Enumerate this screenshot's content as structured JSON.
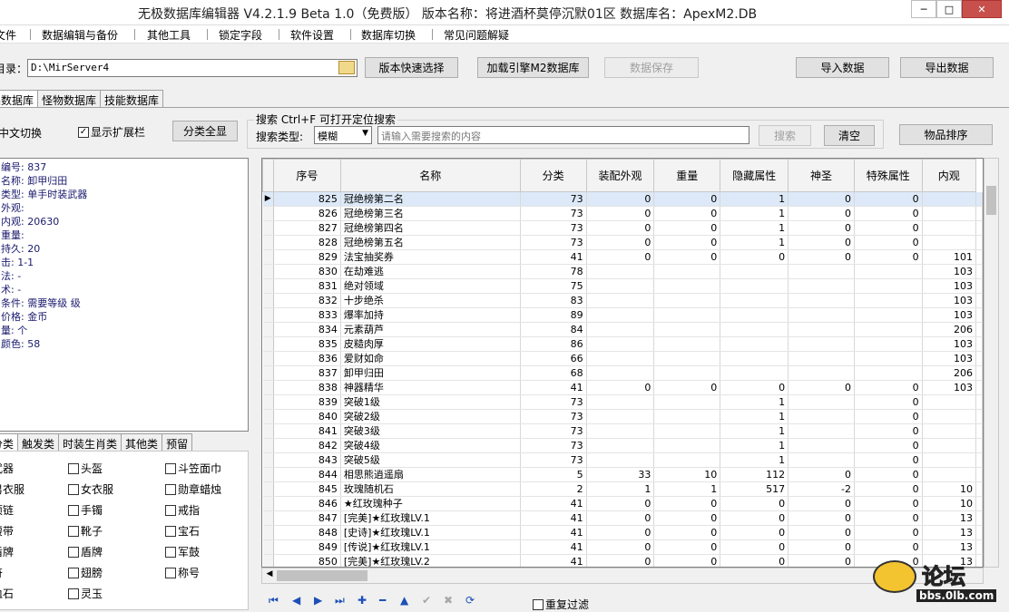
{
  "window": {
    "title": "无极数据库编辑器 V4.2.1.9   Beta 1.0（免费版）   版本名称：将进酒杯莫停沉默01区    数据库名：ApexM2.DB",
    "min": "─",
    "max": "□",
    "close": "✕"
  },
  "menu": [
    "文件",
    "数据编辑与备份",
    "其他工具",
    "锁定字段",
    "软件设置",
    "数据库切换",
    "常见问题解疑"
  ],
  "toolbar": {
    "dir_label": "目录：",
    "dir_value": "D:\\MirServer4",
    "version_quick": "版本快速选择",
    "load_engine": "加载引擎M2数据库",
    "save_data": "数据保存",
    "import_data": "导入数据",
    "export_data": "导出数据"
  },
  "db_tabs": [
    "物品数据库",
    "怪物数据库",
    "技能数据库"
  ],
  "options": {
    "cn_toggle": "中文切换",
    "show_ext": "显示扩展栏",
    "show_ext_checked": true,
    "show_all_categories": "分类全显"
  },
  "search": {
    "title": "搜索   Ctrl+F 可打开定位搜索",
    "type_label": "搜索类型:",
    "type_value": "模糊",
    "placeholder": "请输入需要搜索的内容",
    "search_btn": "搜索",
    "clear_btn": "清空",
    "sort_btn": "物品排序"
  },
  "item_info": [
    "编号: 837",
    "名称: 卸甲归田",
    "类型: 单手时装武器",
    "外观:",
    "内观: 20630",
    "重量:",
    "持久: 20",
    "  击: 1-1",
    "  法: -",
    "  术: -",
    "条件: 需要等级  级",
    "价格: 金币",
    "  量: 个",
    "颜色: 58"
  ],
  "category_tabs": [
    "分类",
    "触发类",
    "时装生肖类",
    "其他类",
    "预留"
  ],
  "categories": [
    [
      "武器",
      "头盔",
      "斗笠面巾"
    ],
    [
      "男衣服",
      "女衣服",
      "勋章蜡烛"
    ],
    [
      "项链",
      "手镯",
      "戒指"
    ],
    [
      "腰带",
      "靴子",
      "宝石"
    ],
    [
      "盾牌",
      "盾牌",
      "军鼓"
    ],
    [
      "符",
      "翅膀",
      "称号"
    ],
    [
      "血石",
      "灵玉",
      ""
    ]
  ],
  "grid": {
    "columns": [
      "序号",
      "名称",
      "分类",
      "装配外观",
      "重量",
      "隐藏属性",
      "神圣",
      "特殊属性",
      "内观"
    ],
    "rows": [
      [
        "825",
        "冠绝榜第二名",
        "73",
        "0",
        "0",
        "1",
        "0",
        "0",
        ""
      ],
      [
        "826",
        "冠绝榜第三名",
        "73",
        "0",
        "0",
        "1",
        "0",
        "0",
        ""
      ],
      [
        "827",
        "冠绝榜第四名",
        "73",
        "0",
        "0",
        "1",
        "0",
        "0",
        ""
      ],
      [
        "828",
        "冠绝榜第五名",
        "73",
        "0",
        "0",
        "1",
        "0",
        "0",
        ""
      ],
      [
        "829",
        "法宝抽奖券",
        "41",
        "0",
        "0",
        "0",
        "0",
        "0",
        "101"
      ],
      [
        "830",
        "在劫难逃",
        "78",
        "",
        "",
        "",
        "",
        "",
        "103"
      ],
      [
        "831",
        "绝对领域",
        "75",
        "",
        "",
        "",
        "",
        "",
        "103"
      ],
      [
        "832",
        "十步绝杀",
        "83",
        "",
        "",
        "",
        "",
        "",
        "103"
      ],
      [
        "833",
        "爆率加持",
        "89",
        "",
        "",
        "",
        "",
        "",
        "103"
      ],
      [
        "834",
        "元素葫芦",
        "84",
        "",
        "",
        "",
        "",
        "",
        "206"
      ],
      [
        "835",
        "皮糙肉厚",
        "86",
        "",
        "",
        "",
        "",
        "",
        "103"
      ],
      [
        "836",
        "爱财如命",
        "66",
        "",
        "",
        "",
        "",
        "",
        "103"
      ],
      [
        "837",
        "卸甲归田",
        "68",
        "",
        "",
        "",
        "",
        "",
        "206"
      ],
      [
        "838",
        "神器精华",
        "41",
        "0",
        "0",
        "0",
        "0",
        "0",
        "103"
      ],
      [
        "839",
        "突破1级",
        "73",
        "",
        "",
        "1",
        "",
        "0",
        ""
      ],
      [
        "840",
        "突破2级",
        "73",
        "",
        "",
        "1",
        "",
        "0",
        ""
      ],
      [
        "841",
        "突破3级",
        "73",
        "",
        "",
        "1",
        "",
        "0",
        ""
      ],
      [
        "842",
        "突破4级",
        "73",
        "",
        "",
        "1",
        "",
        "0",
        ""
      ],
      [
        "843",
        "突破5级",
        "73",
        "",
        "",
        "1",
        "",
        "0",
        ""
      ],
      [
        "844",
        "相思熊逍遥扇",
        "5",
        "33",
        "10",
        "112",
        "0",
        "0",
        ""
      ],
      [
        "845",
        "玫瑰随机石",
        "2",
        "1",
        "1",
        "517",
        "-2",
        "0",
        "10"
      ],
      [
        "846",
        "★红玫瑰种子",
        "41",
        "0",
        "0",
        "0",
        "0",
        "0",
        "10"
      ],
      [
        "847",
        "[完美]★红玫瑰LV.1",
        "41",
        "0",
        "0",
        "0",
        "0",
        "0",
        "13"
      ],
      [
        "848",
        "[史诗]★红玫瑰LV.1",
        "41",
        "0",
        "0",
        "0",
        "0",
        "0",
        "13"
      ],
      [
        "849",
        "[传说]★红玫瑰LV.1",
        "41",
        "0",
        "0",
        "0",
        "0",
        "0",
        "13"
      ],
      [
        "850",
        "[完美]★红玫瑰LV.2",
        "41",
        "0",
        "0",
        "0",
        "0",
        "0",
        "13"
      ]
    ]
  },
  "nav": {
    "icons": [
      "first-icon",
      "prev-icon",
      "next-icon",
      "last-icon",
      "plus-icon",
      "minus-icon",
      "up-icon",
      "check-icon",
      "cancel-icon",
      "refresh-icon"
    ],
    "dup_filter": "重复过滤"
  },
  "watermark": {
    "brand": "论坛",
    "url": "bbs.0lb.com"
  }
}
